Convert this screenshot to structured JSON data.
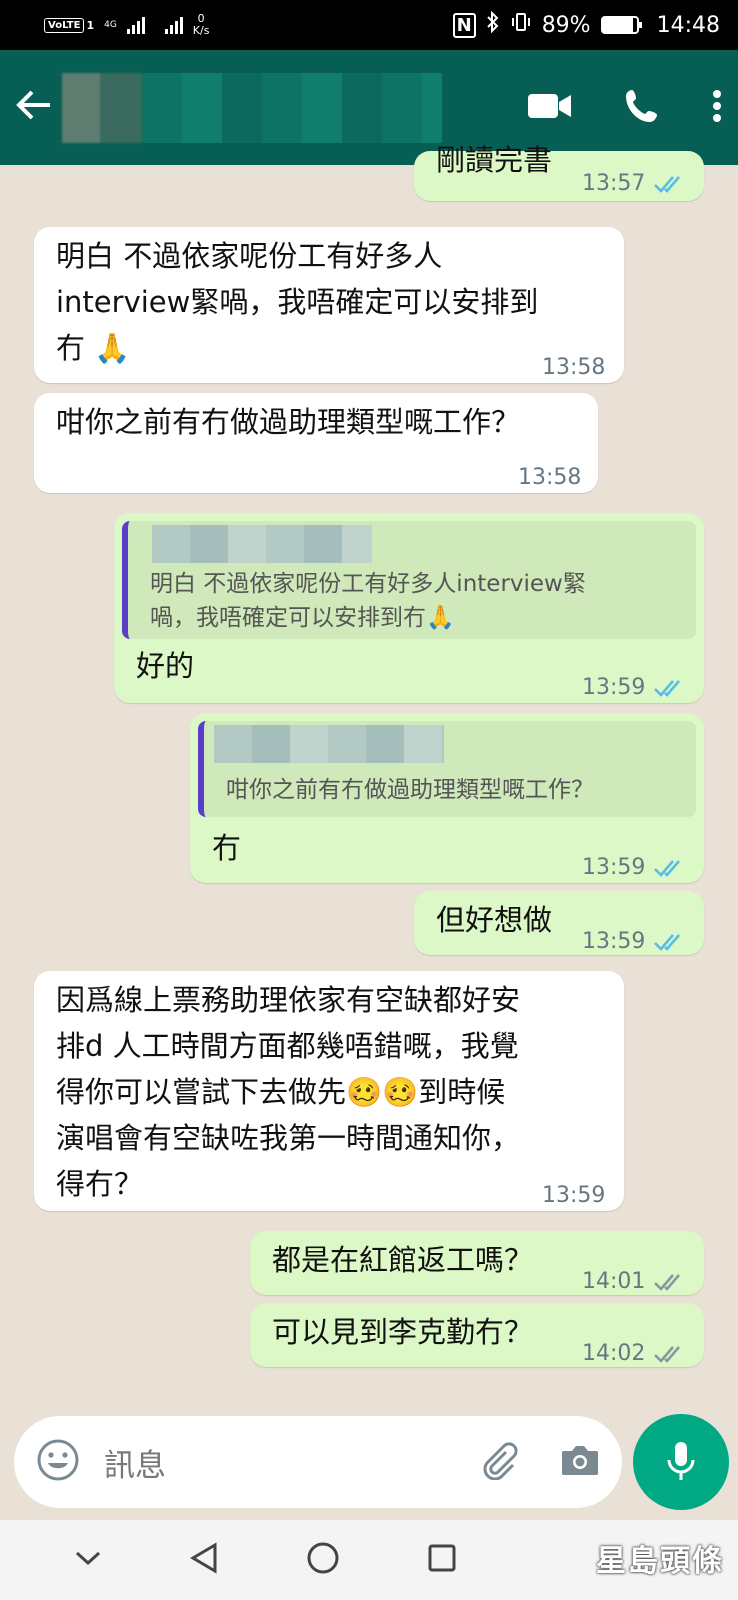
{
  "status_bar": {
    "volte": "VoLTE",
    "sim": "1",
    "network": "4G",
    "speed_value": "0",
    "speed_unit": "K/s",
    "battery_percent": "89%",
    "battery_level": 0.89,
    "time": "14:48"
  },
  "header": {
    "back_icon": "arrow-left-icon",
    "actions": [
      "video-call-icon",
      "phone-icon",
      "more-vert-icon"
    ]
  },
  "messages": [
    {
      "direction": "out",
      "lines": [
        "剛讀完書"
      ],
      "time": "13:57",
      "status": "read"
    },
    {
      "direction": "in",
      "lines": [
        "明白 不過依家呢份工有好多人",
        "interview緊喎，我唔確定可以安排到",
        "冇"
      ],
      "emoji_after": "🙏",
      "time": "13:58"
    },
    {
      "direction": "in",
      "lines": [
        "咁你之前有冇做過助理類型嘅工作？"
      ],
      "time": "13:58"
    },
    {
      "direction": "out",
      "quote": [
        "明白 不過依家呢份工有好多人interview緊",
        "喎，我唔確定可以安排到冇🙏"
      ],
      "lines": [
        "好的"
      ],
      "time": "13:59",
      "status": "read"
    },
    {
      "direction": "out",
      "quote": [
        "咁你之前有冇做過助理類型嘅工作？"
      ],
      "lines": [
        "冇"
      ],
      "time": "13:59",
      "status": "read"
    },
    {
      "direction": "out",
      "lines": [
        "但好想做"
      ],
      "time": "13:59",
      "status": "read"
    },
    {
      "direction": "in",
      "lines": [
        "因爲線上票務助理依家有空缺都好安",
        "排d 人工時間方面都幾唔錯嘅，我覺",
        "得你可以嘗試下去做先",
        "演唱會有空缺咗我第一時間通知你，",
        "得冇？"
      ],
      "line3_suffix": "到時候",
      "emoji_mid": "🥴🥴",
      "time": "13:59"
    },
    {
      "direction": "out",
      "lines": [
        "都是在紅館返工嗎？"
      ],
      "time": "14:01",
      "status": "delivered"
    },
    {
      "direction": "out",
      "lines": [
        "可以見到李克勤冇？"
      ],
      "time": "14:02",
      "status": "delivered"
    }
  ],
  "input": {
    "placeholder": "訊息",
    "emoji_icon": "emoji-icon",
    "attach_icon": "paperclip-icon",
    "camera_icon": "camera-icon",
    "mic_icon": "mic-icon"
  },
  "nav": [
    "chevron-down-icon",
    "back-triangle-icon",
    "home-circle-icon",
    "recents-square-icon"
  ],
  "watermark": "星島頭條",
  "colors": {
    "header": "#075e54",
    "outgoing": "#dcf8c6",
    "incoming": "#ffffff",
    "read_ticks": "#53bdeb",
    "mic": "#00a884"
  }
}
